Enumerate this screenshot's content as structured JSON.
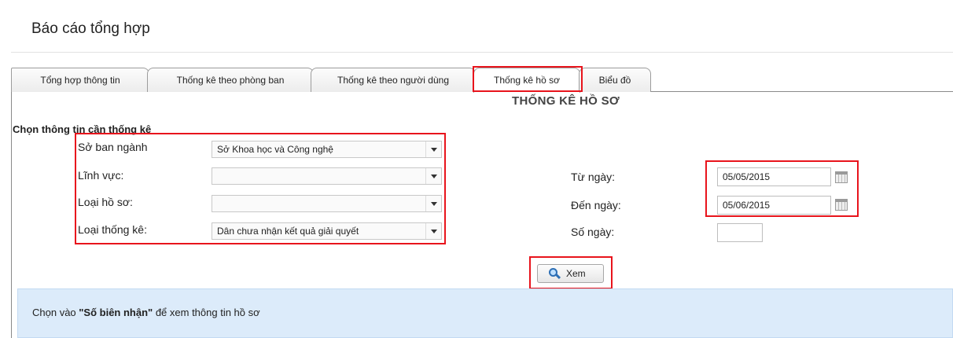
{
  "page": {
    "title": "Báo cáo tổng hợp"
  },
  "tabs": [
    {
      "label": "Tổng hợp thông tin"
    },
    {
      "label": "Thống kê theo phòng ban"
    },
    {
      "label": "Thống kê theo người dùng"
    },
    {
      "label": "Thống kê hồ sơ",
      "active": true
    },
    {
      "label": "Biểu đồ"
    }
  ],
  "section": {
    "title": "THỐNG KÊ HỒ SƠ",
    "subheading": "Chọn thông tin cần thống kê"
  },
  "filters": {
    "so_ban_nganh": {
      "label": "Sở ban ngành",
      "value": "Sở Khoa học và Công nghệ"
    },
    "linh_vuc": {
      "label": "Lĩnh vực:",
      "value": ""
    },
    "loai_ho_so": {
      "label": "Loại hồ sơ:",
      "value": ""
    },
    "loai_thong_ke": {
      "label": "Loại thống kê:",
      "value": "Dân chưa nhận kết quả giải quyết"
    }
  },
  "dates": {
    "tu_ngay": {
      "label": "Từ ngày:",
      "value": "05/05/2015"
    },
    "den_ngay": {
      "label": "Đến ngày:",
      "value": "05/06/2015"
    },
    "so_ngay": {
      "label": "Số ngày:",
      "value": ""
    }
  },
  "actions": {
    "view_label": "Xem",
    "view_icon": "search-icon"
  },
  "info": {
    "prefix": "Chọn vào ",
    "emphasis": "\"Số biên nhận\"",
    "suffix": " để xem thông tin hồ sơ"
  },
  "colors": {
    "highlight": "#e8141c",
    "info_bg": "#dcebfa"
  }
}
